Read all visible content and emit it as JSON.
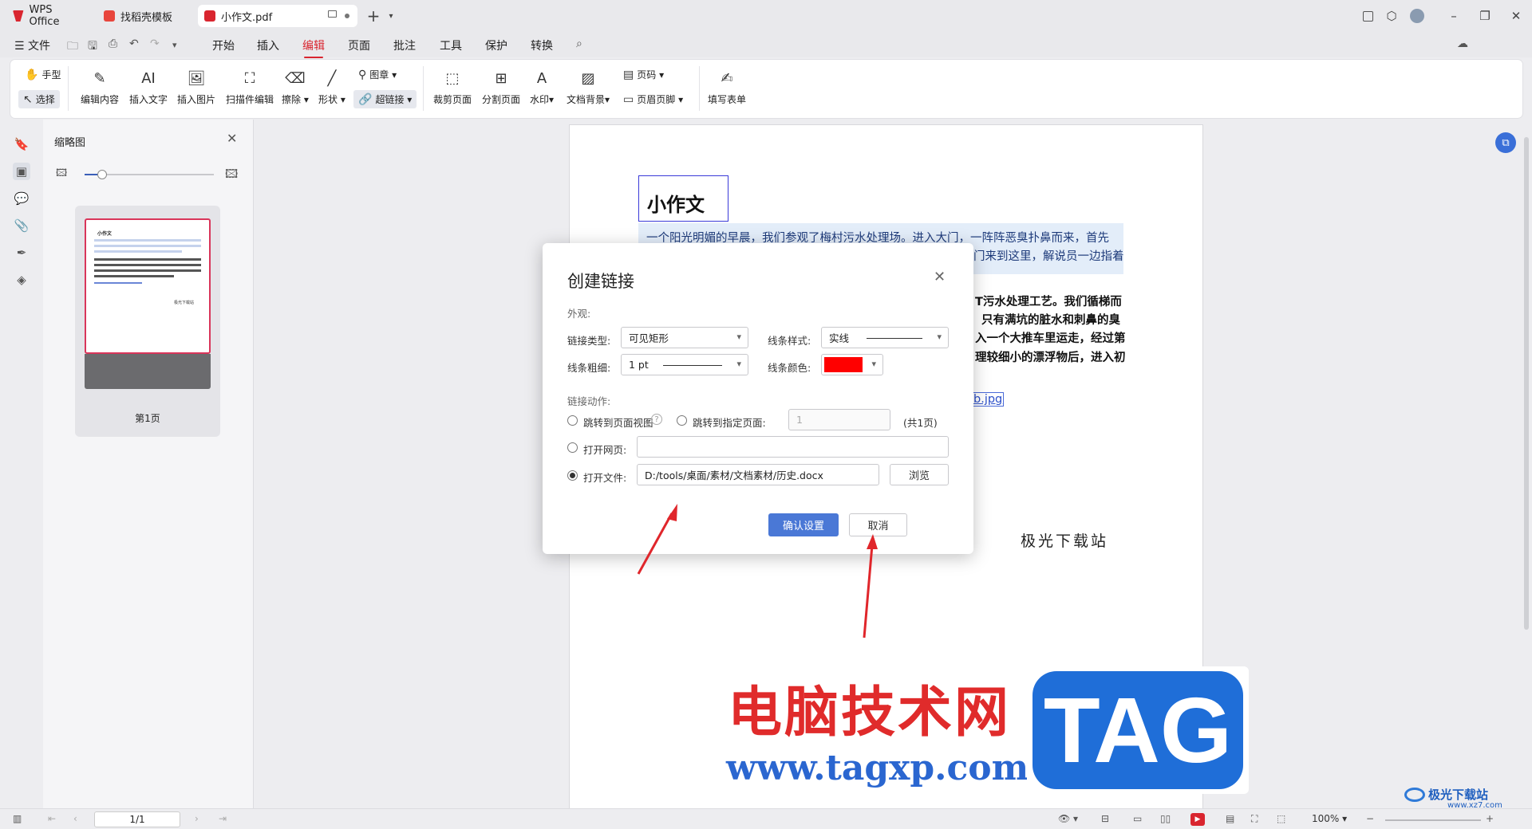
{
  "titlebar": {
    "tabs": [
      {
        "label": "WPS Office",
        "color": "#d9252f"
      },
      {
        "label": "找稻壳模板",
        "color": "#e8453c"
      },
      {
        "label": "小作文.pdf",
        "color": "#d9252f"
      }
    ],
    "new_tab": "+",
    "share_label": "分享"
  },
  "menubar": {
    "file": "文件",
    "items": [
      "开始",
      "插入",
      "编辑",
      "页面",
      "批注",
      "工具",
      "保护",
      "转换"
    ],
    "active": "编辑"
  },
  "toolbar": {
    "hand": "手型",
    "select": "选择",
    "edit_content": "编辑内容",
    "insert_text": "插入文字",
    "insert_image": "插入图片",
    "scan_edit": "扫描件编辑",
    "erase": "擦除",
    "shape": "形状",
    "stamp": "图章",
    "hyperlink": "超链接",
    "crop_page": "裁剪页面",
    "split_page": "分割页面",
    "watermark": "水印",
    "doc_bg": "文档背景",
    "page_num": "页码",
    "header_footer": "页眉页脚",
    "fill_form": "填写表单"
  },
  "thumbnails": {
    "title": "缩略图",
    "page_label": "第1页",
    "mini_title": "小作文",
    "mini_signature": "极光下载站"
  },
  "document": {
    "title": "小作文",
    "lines": [
      "一个阳光明媚的早晨，我们参观了梅村污水处理场。进入大门，一阵阵恶臭扑鼻而来，首先",
      "门来到这里，解说员一边指着"
    ],
    "bold_lines": [
      "T污水处理工艺。我们循梯而",
      "只有满坑的脏水和刺鼻的臭",
      "入一个大推车里运走，经过第",
      "理较细小的漂浮物后，进入初"
    ],
    "link_text": "b.jpg",
    "signature": "极光下载站"
  },
  "dialog": {
    "title": "创建链接",
    "appearance": "外观:",
    "link_type_label": "链接类型:",
    "link_type_value": "可见矩形",
    "line_style_label": "线条样式:",
    "line_style_value": "实线",
    "line_width_label": "线条粗细:",
    "line_width_value": "1 pt",
    "line_color_label": "线条颜色:",
    "line_color": "#ff0000",
    "action_label": "链接动作:",
    "goto_view": "跳转到页面视图",
    "goto_page": "跳转到指定页面:",
    "goto_page_value": "1",
    "total_pages": "(共1页)",
    "open_web": "打开网页:",
    "open_file": "打开文件:",
    "file_path": "D:/tools/桌面/素材/文档素材/历史.docx",
    "browse": "浏览",
    "confirm": "确认设置",
    "cancel": "取消"
  },
  "watermark": {
    "cn": "电脑技术网",
    "tag": "TAG",
    "url": "www.tagxp.com",
    "corner": "极光下载站",
    "corner_url": "www.xz7.com"
  },
  "statusbar": {
    "page_input": "1/1",
    "zoom": "100%"
  }
}
